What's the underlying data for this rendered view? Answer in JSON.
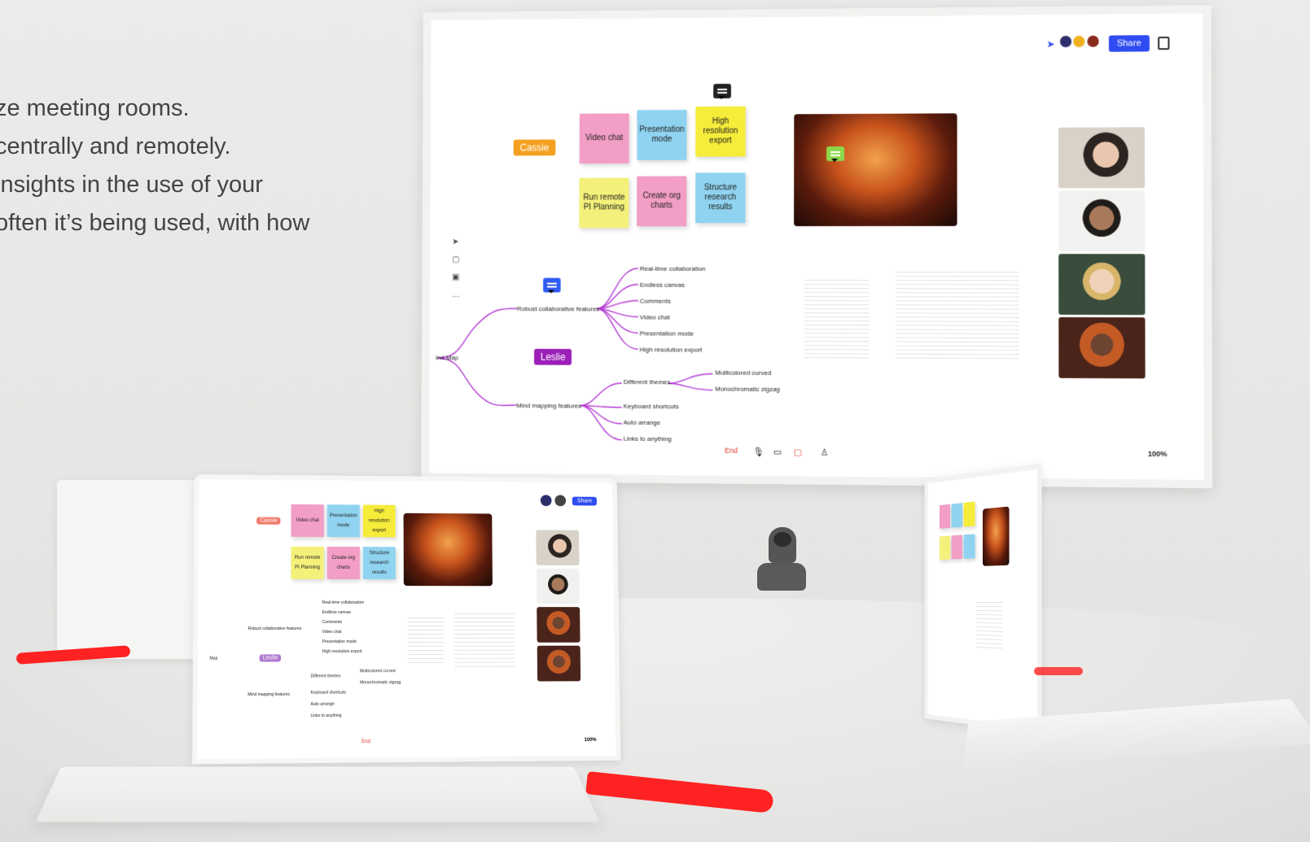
{
  "copy": {
    "lines": [
      "ze meeting rooms.",
      "centrally and remotely.",
      "insights in the use of your",
      "often it’s being used, with how"
    ]
  },
  "wall": {
    "toolbar": {
      "share_label": "Share",
      "pointer_icon": "pointer-icon",
      "board_icon": "board-icon"
    },
    "stickies": [
      {
        "label": "Video chat",
        "color": "#f29ec6"
      },
      {
        "label": "Presentation mode",
        "color": "#8fd3f0"
      },
      {
        "label": "High resolution export",
        "color": "#f6ec3a"
      },
      {
        "label": "Run remote PI Planning",
        "color": "#f4f17a"
      },
      {
        "label": "Create org charts",
        "color": "#f29ec6"
      },
      {
        "label": "Structure research results",
        "color": "#8fd3f0"
      }
    ],
    "cursors": {
      "cassie": "Cassie",
      "leslie": "Leslie"
    },
    "mindmap": {
      "root": "ind Map",
      "branch1": "Robust collaborative features",
      "branch1_items": [
        "Real-time collaboration",
        "Endless canvas",
        "Comments",
        "Video chat",
        "Presentation mode",
        "High resolution export"
      ],
      "branch2": "Mind mapping features",
      "branch2_items": [
        "Different themes",
        "Keyboard shortcuts",
        "Auto arrange",
        "Links to anything"
      ],
      "themes_items": [
        "Multicolored curved",
        "Monochromatic zigzag"
      ]
    },
    "bottom": {
      "end_label": "End",
      "zoom": "100%"
    }
  },
  "laptop_left": {
    "share_label": "Share",
    "stickies": [
      "Video chat",
      "Presentation mode",
      "High resolution export",
      "Run remote PI Planning",
      "Create org charts",
      "Structure research results"
    ],
    "cursors": {
      "cassie": "Cassie",
      "leslie": "Leslie"
    },
    "mindmap": {
      "root": "Map",
      "branch1": "Robust collaborative features",
      "branch1_items": [
        "Real-time collaboration",
        "Endless canvas",
        "Comments",
        "Video chat",
        "Presentation mode",
        "High resolution export"
      ],
      "branch2": "Mind mapping features",
      "branch2_items": [
        "Different themes",
        "Keyboard shortcuts",
        "Auto arrange",
        "Links to anything"
      ],
      "themes_items": [
        "Multicolored curved",
        "Monochromatic zigzag"
      ]
    },
    "bottom": {
      "end_label": "End",
      "zoom": "100%"
    }
  },
  "colors": {
    "accent": "#2f4cf2",
    "cassie": "#f5a020",
    "leslie": "#9b1fb8",
    "dongle": "#f21d1d"
  }
}
